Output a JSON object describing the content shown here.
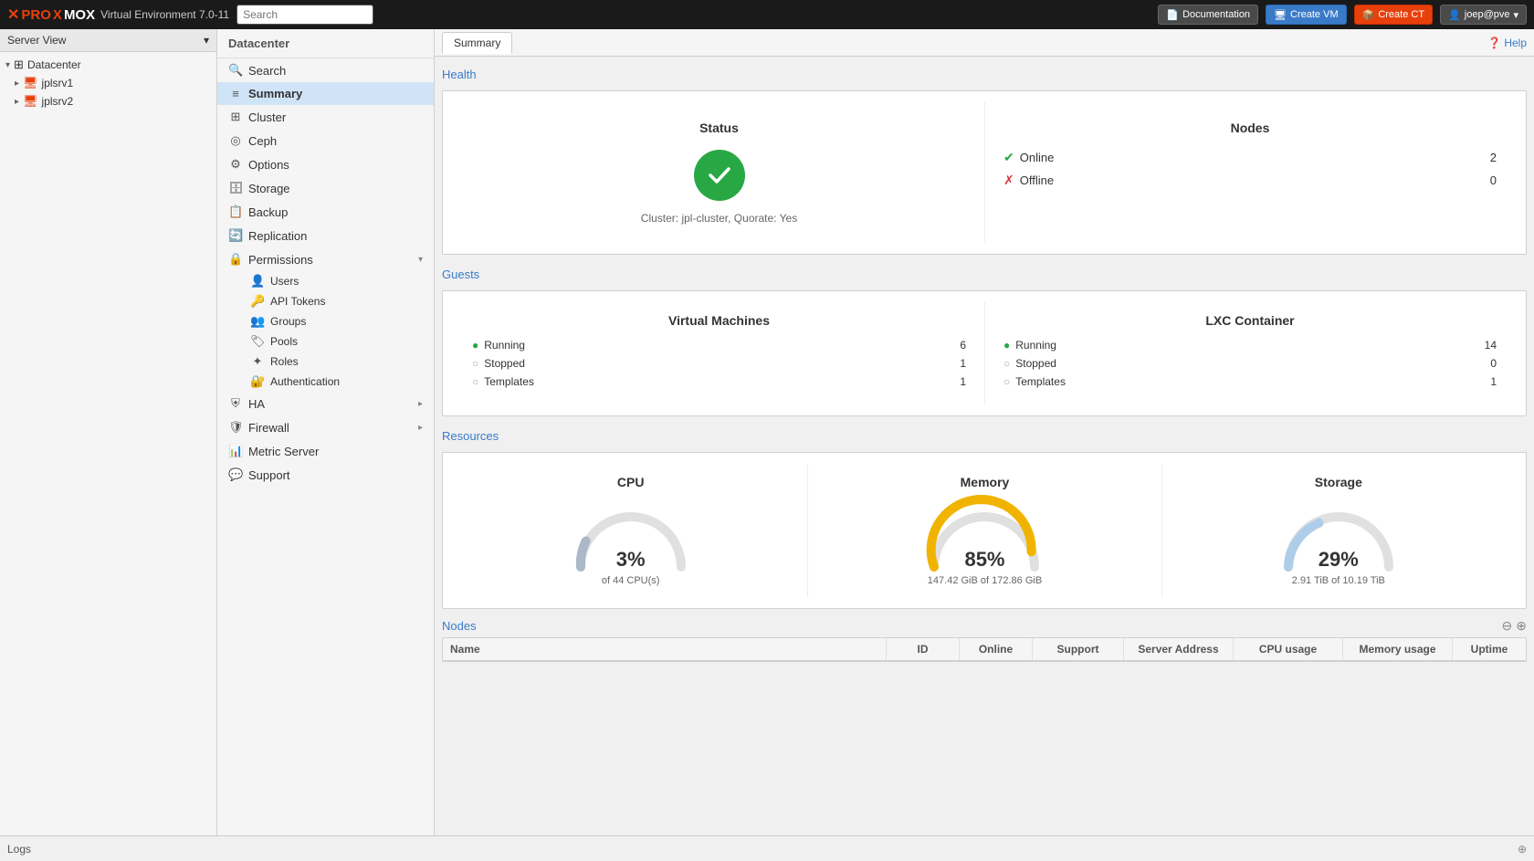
{
  "topbar": {
    "logo_proxmox": "PROXMOX",
    "logo_x1": "X",
    "logo_prox": "PRO",
    "logo_x2": "X",
    "logo_mox": "MOX",
    "subtitle": "Virtual Environment 7.0-11",
    "search_placeholder": "Search",
    "doc_btn": "Documentation",
    "create_vm_btn": "Create VM",
    "create_ct_btn": "Create CT",
    "user_btn": "joep@pve",
    "help_btn": "Help"
  },
  "left_panel": {
    "server_view_label": "Server View",
    "tree_items": [
      {
        "label": "Datacenter",
        "level": 0,
        "icon": "datacenter"
      },
      {
        "label": "jplsrv1",
        "level": 1,
        "icon": "node"
      },
      {
        "label": "jplsrv2",
        "level": 1,
        "icon": "node"
      }
    ]
  },
  "nav": {
    "header": "Datacenter",
    "items": [
      {
        "label": "Search",
        "icon": "🔍",
        "key": "search"
      },
      {
        "label": "Summary",
        "icon": "≡",
        "key": "summary",
        "active": true
      },
      {
        "label": "Cluster",
        "icon": "⊞",
        "key": "cluster"
      },
      {
        "label": "Ceph",
        "icon": "◎",
        "key": "ceph"
      },
      {
        "label": "Options",
        "icon": "⚙",
        "key": "options"
      },
      {
        "label": "Storage",
        "icon": "🗄",
        "key": "storage"
      },
      {
        "label": "Backup",
        "icon": "📋",
        "key": "backup"
      },
      {
        "label": "Replication",
        "icon": "🔄",
        "key": "replication"
      },
      {
        "label": "Permissions",
        "icon": "🔒",
        "key": "permissions",
        "expandable": true
      },
      {
        "label": "Users",
        "icon": "👤",
        "key": "users",
        "sub": true
      },
      {
        "label": "API Tokens",
        "icon": "🔑",
        "key": "api-tokens",
        "sub": true
      },
      {
        "label": "Groups",
        "icon": "👥",
        "key": "groups",
        "sub": true
      },
      {
        "label": "Pools",
        "icon": "🏷",
        "key": "pools",
        "sub": true
      },
      {
        "label": "Roles",
        "icon": "✦",
        "key": "roles",
        "sub": true
      },
      {
        "label": "Authentication",
        "icon": "🔐",
        "key": "authentication",
        "sub": true
      },
      {
        "label": "HA",
        "icon": "⛨",
        "key": "ha",
        "expandable": true
      },
      {
        "label": "Firewall",
        "icon": "🛡",
        "key": "firewall",
        "expandable": true
      },
      {
        "label": "Metric Server",
        "icon": "📊",
        "key": "metric-server"
      },
      {
        "label": "Support",
        "icon": "💬",
        "key": "support"
      }
    ]
  },
  "content": {
    "tab_summary": "Summary",
    "help_label": "Help",
    "health_section": "Health",
    "status_title": "Status",
    "nodes_title": "Nodes",
    "online_label": "Online",
    "online_count": "2",
    "offline_label": "Offline",
    "offline_count": "0",
    "cluster_info": "Cluster: jpl-cluster, Quorate: Yes",
    "guests_section": "Guests",
    "vm_title": "Virtual Machines",
    "lxc_title": "LXC Container",
    "vm_running": "Running",
    "vm_running_count": "6",
    "vm_stopped": "Stopped",
    "vm_stopped_count": "1",
    "vm_templates": "Templates",
    "vm_templates_count": "1",
    "lxc_running": "Running",
    "lxc_running_count": "14",
    "lxc_stopped": "Stopped",
    "lxc_stopped_count": "0",
    "lxc_templates": "Templates",
    "lxc_templates_count": "1",
    "resources_section": "Resources",
    "cpu_title": "CPU",
    "cpu_pct": "3%",
    "cpu_sub": "of 44 CPU(s)",
    "cpu_value": 3,
    "memory_title": "Memory",
    "memory_pct": "85%",
    "memory_sub": "147.42 GiB of 172.86 GiB",
    "memory_value": 85,
    "storage_title": "Storage",
    "storage_pct": "29%",
    "storage_sub": "2.91 TiB of 10.19 TiB",
    "storage_value": 29,
    "nodes_section": "Nodes",
    "nodes_col_name": "Name",
    "nodes_col_id": "ID",
    "nodes_col_online": "Online",
    "nodes_col_support": "Support",
    "nodes_col_server": "Server Address",
    "nodes_col_cpu": "CPU usage",
    "nodes_col_memory": "Memory usage",
    "nodes_col_uptime": "Uptime"
  },
  "logs_bar": {
    "label": "Logs"
  }
}
